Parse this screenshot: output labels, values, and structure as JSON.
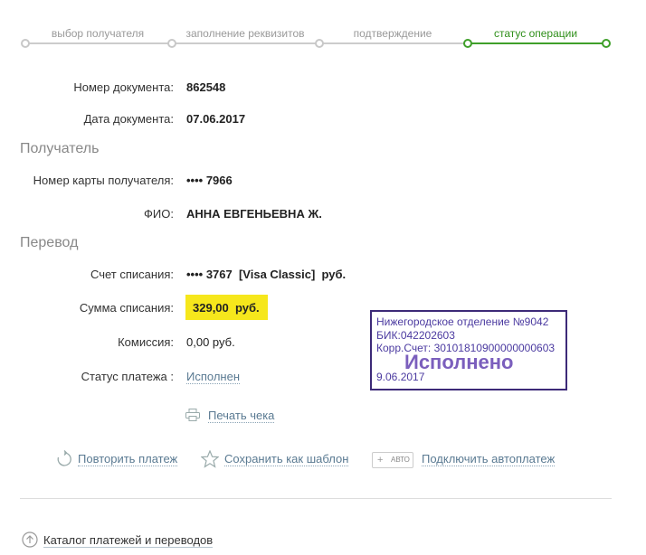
{
  "steps": [
    {
      "label": "выбор получателя",
      "state": "done"
    },
    {
      "label": "заполнение реквизитов",
      "state": "done"
    },
    {
      "label": "подтверждение",
      "state": "done"
    },
    {
      "label": "статус операции",
      "state": "active"
    }
  ],
  "document": {
    "number_label": "Номер документа:",
    "number_value": "862548",
    "date_label": "Дата документа:",
    "date_value": "07.06.2017"
  },
  "recipient": {
    "section_title": "Получатель",
    "card_label": "Номер карты получателя:",
    "card_value": "•••• 7966",
    "name_label": "ФИО:",
    "name_value": "АННА ЕВГЕНЬЕВНА Ж."
  },
  "transfer": {
    "section_title": "Перевод",
    "account_label": "Счет списания:",
    "account_value": "•••• 3767  [Visa Classic]  руб.",
    "amount_label": "Сумма списания:",
    "amount_value": "329,00  руб.",
    "fee_label": "Комиссия:",
    "fee_value": "0,00 руб.",
    "status_label": "Статус платежа :",
    "status_value": "Исполнен"
  },
  "stamp": {
    "line1": "Нижегородское отделение №9042",
    "line2": "БИК:042202603",
    "line3": "Корр.Счет: 30101810900000000603",
    "status": "Исполнено",
    "date": "9.06.2017"
  },
  "print_label": "Печать чека",
  "actions": {
    "repeat": "Повторить платеж",
    "save_template": "Сохранить как шаблон",
    "auto_badge": "АВТО",
    "autopay": "Подключить автоплатеж"
  },
  "catalog_link": "Каталог платежей и переводов",
  "colors": {
    "accent_green": "#3f9f2a",
    "highlight_yellow": "#f6e71c",
    "stamp_purple": "#3d2a78",
    "link_blue": "#5a7a92"
  }
}
